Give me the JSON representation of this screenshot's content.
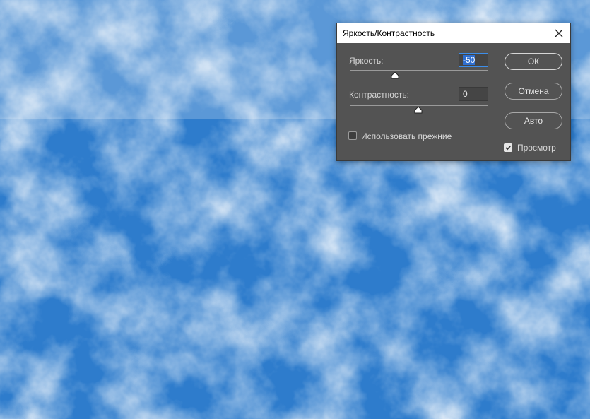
{
  "dialog": {
    "title": "Яркость/Контрастность",
    "close_icon": "close-icon"
  },
  "brightness": {
    "label": "Яркость:",
    "value": "-50",
    "slider_min": -150,
    "slider_max": 150
  },
  "contrast": {
    "label": "Контрастность:",
    "value": "0",
    "slider_min": -50,
    "slider_max": 100
  },
  "use_legacy": {
    "label": "Использовать прежние",
    "checked": false
  },
  "buttons": {
    "ok": "ОК",
    "cancel": "Отмена",
    "auto": "Авто"
  },
  "preview": {
    "label": "Просмотр",
    "checked": true
  },
  "colors": {
    "dialog_bg": "#535353",
    "sky_blue": "#2f7fd0",
    "focus_accent": "#3d8eea"
  }
}
